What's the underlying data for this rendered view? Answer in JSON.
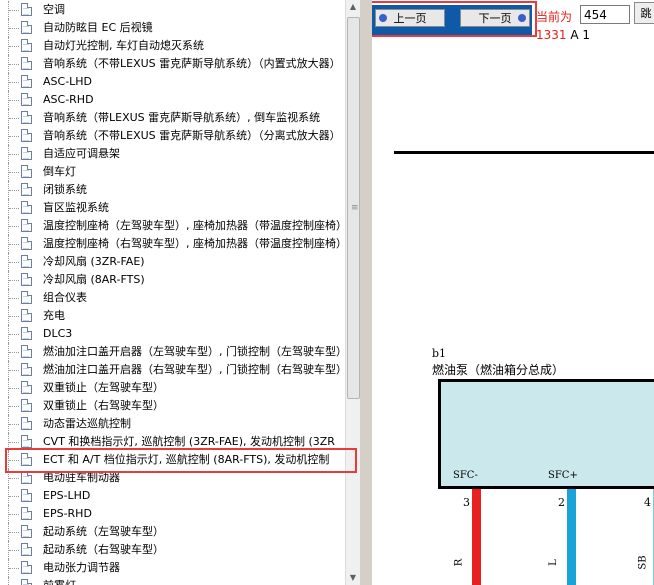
{
  "tree": {
    "items": [
      {
        "label": "空调"
      },
      {
        "label": "自动防眩目 EC 后视镜"
      },
      {
        "label": "自动灯光控制, 车灯自动熄灭系统"
      },
      {
        "label": "音响系统（不带LEXUS 雷克萨斯导航系统）（内置式放大器）"
      },
      {
        "label": "ASC-LHD"
      },
      {
        "label": "ASC-RHD"
      },
      {
        "label": "音响系统（带LEXUS 雷克萨斯导航系统）, 倒车监视系统"
      },
      {
        "label": "音响系统（不带LEXUS 雷克萨斯导航系统）（分离式放大器）"
      },
      {
        "label": "自适应可调悬架"
      },
      {
        "label": "倒车灯"
      },
      {
        "label": "闭锁系统"
      },
      {
        "label": "盲区监视系统"
      },
      {
        "label": "温度控制座椅（左驾驶车型）, 座椅加热器（带温度控制座椅）"
      },
      {
        "label": "温度控制座椅（右驾驶车型）, 座椅加热器（带温度控制座椅）"
      },
      {
        "label": "冷却风扇 (3ZR-FAE)"
      },
      {
        "label": "冷却风扇 (8AR-FTS)"
      },
      {
        "label": "组合仪表"
      },
      {
        "label": "充电"
      },
      {
        "label": "DLC3"
      },
      {
        "label": "燃油加注口盖开启器（左驾驶车型）, 门锁控制（左驾驶车型）"
      },
      {
        "label": "燃油加注口盖开启器（右驾驶车型）, 门锁控制（右驾驶车型）"
      },
      {
        "label": "双重锁止（左驾驶车型）"
      },
      {
        "label": "双重锁止（右驾驶车型）"
      },
      {
        "label": "动态雷达巡航控制"
      },
      {
        "label": "CVT 和换档指示灯, 巡航控制 (3ZR-FAE), 发动机控制 (3ZR"
      },
      {
        "label": "ECT 和 A/T 档位指示灯, 巡航控制 (8AR-FTS), 发动机控制"
      },
      {
        "label": "电动驻车制动器"
      },
      {
        "label": "EPS-LHD"
      },
      {
        "label": "EPS-RHD"
      },
      {
        "label": "起动系统（左驾驶车型）"
      },
      {
        "label": "起动系统（右驾驶车型）"
      },
      {
        "label": "电动张力调节器"
      },
      {
        "label": "前雾灯"
      }
    ]
  },
  "nav": {
    "prev_label": "上一页",
    "next_label": "下一页",
    "current_label": "当前为",
    "page_value": "454",
    "go_label": "跳",
    "page_info_red": "1331",
    "page_info_rest": " A 1"
  },
  "diagram": {
    "ref": "b1",
    "title": "燃油泵（燃油箱分总成）",
    "pins": [
      {
        "name": "SFC-",
        "num": "3",
        "wire": "R",
        "color": "#e82020"
      },
      {
        "name": "SFC+",
        "num": "2",
        "wire": "L",
        "color": "#1aa3d8"
      },
      {
        "name": "",
        "num": "4",
        "wire": "SB",
        "color": "#6fd3d8"
      }
    ]
  }
}
